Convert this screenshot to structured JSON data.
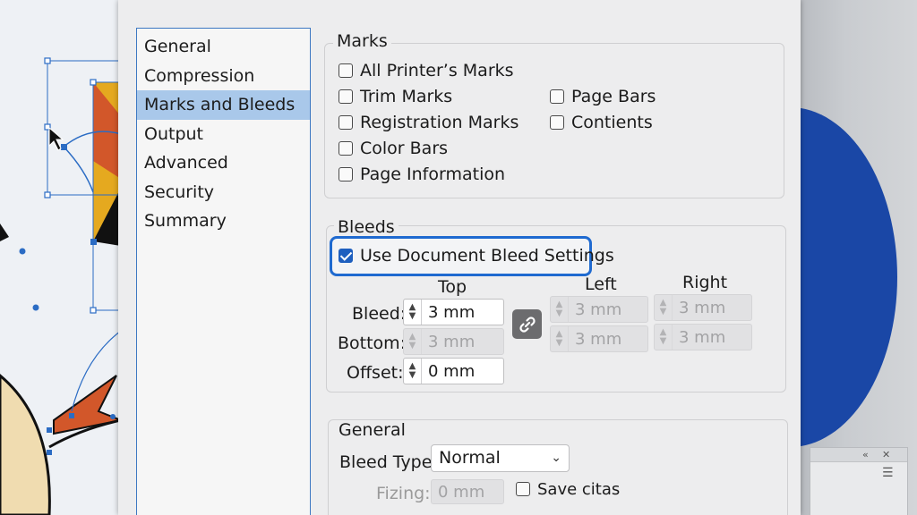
{
  "nav": {
    "items": [
      {
        "label": "General"
      },
      {
        "label": "Compression"
      },
      {
        "label": "Marks and Bleeds",
        "selected": true
      },
      {
        "label": "Output"
      },
      {
        "label": "Advanced"
      },
      {
        "label": "Security"
      },
      {
        "label": "Summary"
      }
    ]
  },
  "marks": {
    "title": "Marks",
    "all_printers_marks": {
      "label": "All Printer’s Marks",
      "checked": false
    },
    "trim_marks": {
      "label": "Trim Marks",
      "checked": false
    },
    "registration_marks": {
      "label": "Registration Marks",
      "checked": false
    },
    "color_bars": {
      "label": "Color Bars",
      "checked": false
    },
    "page_information": {
      "label": "Page Information",
      "checked": false
    },
    "page_bars": {
      "label": "Page Bars",
      "checked": false
    },
    "contients": {
      "label": "Contients",
      "checked": false
    }
  },
  "bleeds": {
    "title": "Bleeds",
    "use_document_bleed": {
      "label": "Use Document Bleed Settings",
      "checked": true
    },
    "col_top": "Top",
    "col_left": "Left",
    "col_right": "Right",
    "bleed_label": "Bleed:",
    "bottom_label": "Bottom:",
    "offset_label": "Offset:",
    "bleed_top": "3 mm",
    "bottom_top": "3 mm",
    "offset_top": "0 mm",
    "left_1": "3 mm",
    "left_2": "3 mm",
    "right_1": "3 mm",
    "right_2": "3 mm"
  },
  "general": {
    "title": "General",
    "bleed_type_label": "Bleed Type:",
    "bleed_type_value": "Normal",
    "fizing_label": "Fizing:",
    "fizing_value": "0 mm",
    "save_citas": {
      "label": "Save citas",
      "checked": false
    }
  },
  "colors": {
    "accent": "#1f6ad0",
    "nav_selected": "#a9c8ea",
    "artwork_blue": "#1a47a6"
  }
}
